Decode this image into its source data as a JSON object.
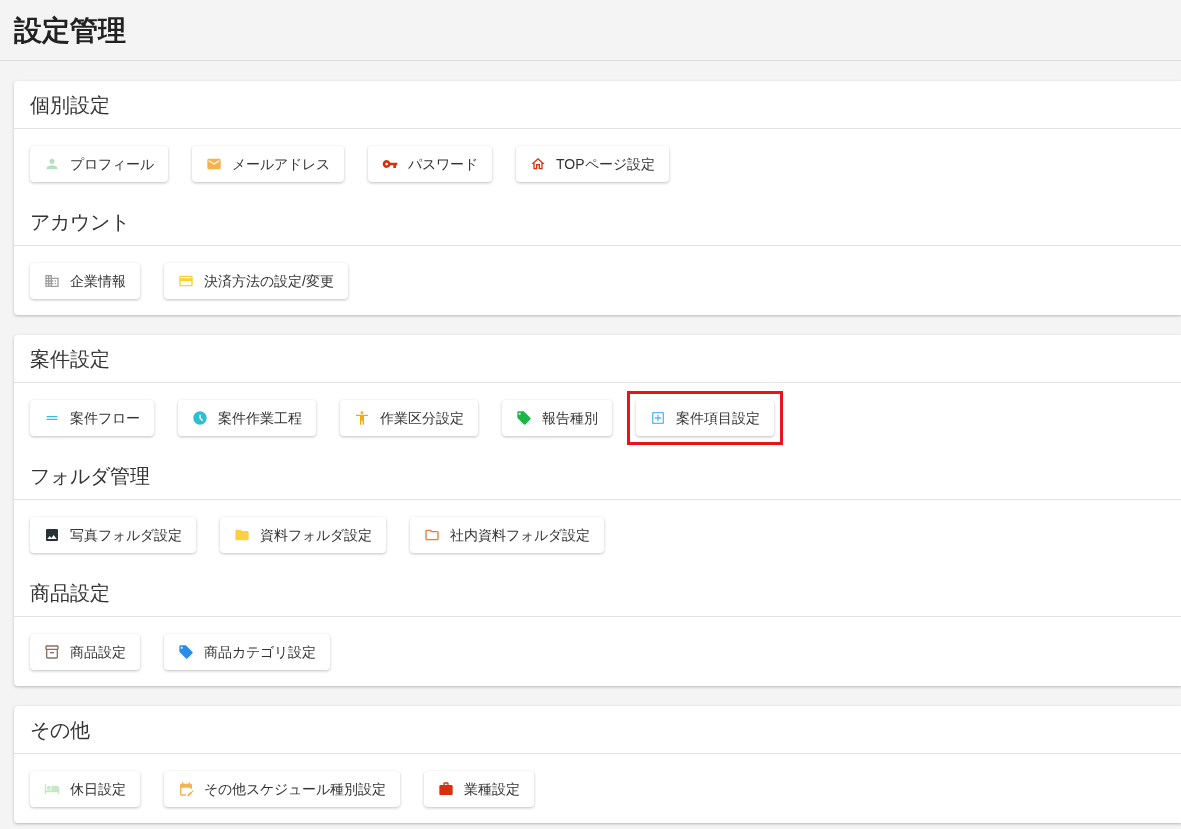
{
  "page_title": "設定管理",
  "cards": [
    {
      "groups": [
        {
          "heading": "個別設定",
          "buttons": [
            {
              "label": "プロフィール",
              "kind": "person",
              "highlighted": false
            },
            {
              "label": "メールアドレス",
              "kind": "mail",
              "highlighted": false
            },
            {
              "label": "パスワード",
              "kind": "key",
              "highlighted": false
            },
            {
              "label": "TOPページ設定",
              "kind": "home",
              "highlighted": false
            }
          ]
        },
        {
          "heading": "アカウント",
          "buttons": [
            {
              "label": "企業情報",
              "kind": "building",
              "highlighted": false
            },
            {
              "label": "決済方法の設定/変更",
              "kind": "card",
              "highlighted": false
            }
          ]
        }
      ]
    },
    {
      "groups": [
        {
          "heading": "案件設定",
          "buttons": [
            {
              "label": "案件フロー",
              "kind": "flow",
              "highlighted": false
            },
            {
              "label": "案件作業工程",
              "kind": "clock",
              "highlighted": false
            },
            {
              "label": "作業区分設定",
              "kind": "figure",
              "highlighted": false
            },
            {
              "label": "報告種別",
              "kind": "tag",
              "highlighted": false
            },
            {
              "label": "案件項目設定",
              "kind": "addbox",
              "highlighted": true
            }
          ]
        },
        {
          "heading": "フォルダ管理",
          "buttons": [
            {
              "label": "写真フォルダ設定",
              "kind": "photo",
              "highlighted": false
            },
            {
              "label": "資料フォルダ設定",
              "kind": "folder",
              "highlighted": false
            },
            {
              "label": "社内資料フォルダ設定",
              "kind": "keyfolder",
              "highlighted": false
            }
          ]
        },
        {
          "heading": "商品設定",
          "buttons": [
            {
              "label": "商品設定",
              "kind": "package",
              "highlighted": false
            },
            {
              "label": "商品カテゴリ設定",
              "kind": "label",
              "highlighted": false
            }
          ]
        }
      ]
    },
    {
      "groups": [
        {
          "heading": "その他",
          "buttons": [
            {
              "label": "休日設定",
              "kind": "bed",
              "highlighted": false
            },
            {
              "label": "その他スケジュール種別設定",
              "kind": "calendar",
              "highlighted": false
            },
            {
              "label": "業種設定",
              "kind": "briefcase",
              "highlighted": false
            }
          ]
        }
      ]
    }
  ]
}
